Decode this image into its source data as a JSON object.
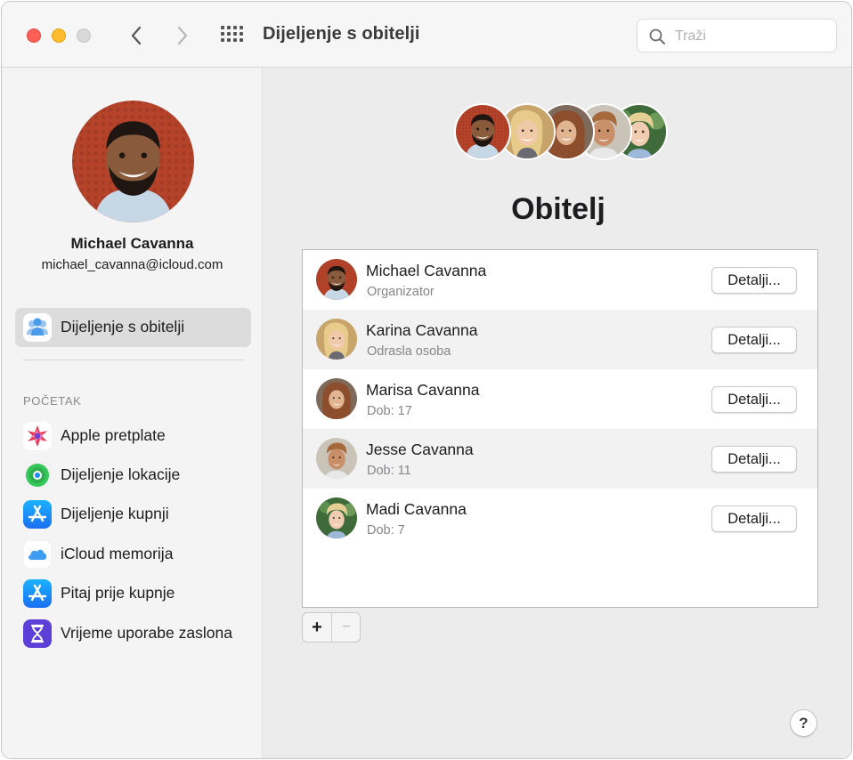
{
  "window": {
    "title": "Dijeljenje s obitelji",
    "search_placeholder": "Traži",
    "traffic_light_colors": {
      "close": "#fe5f57",
      "minimize": "#febc2e",
      "zoom": "#d9d9d9"
    }
  },
  "toolbar": {
    "back_icon": "chevron-left-icon",
    "forward_icon": "chevron-right-icon",
    "grid_icon": "grid-icon",
    "search_icon": "search-icon"
  },
  "sidebar": {
    "profile": {
      "name": "Michael Cavanna",
      "email": "michael_cavanna@icloud.com"
    },
    "family_item": {
      "label": "Dijeljenje s obitelji",
      "icon": "family-icon"
    },
    "section_header": "POČETAK",
    "items": [
      {
        "label": "Apple pretplate",
        "icon": "subscriptions-icon"
      },
      {
        "label": "Dijeljenje lokacije",
        "icon": "find-my-icon"
      },
      {
        "label": "Dijeljenje kupnji",
        "icon": "app-store-icon"
      },
      {
        "label": "iCloud memorija",
        "icon": "icloud-icon"
      },
      {
        "label": "Pitaj prije kupnje",
        "icon": "app-store-icon"
      },
      {
        "label": "Vrijeme uporabe zaslona",
        "icon": "hourglass-icon"
      }
    ]
  },
  "main": {
    "title": "Obitelj",
    "details_label": "Detalji...",
    "members": [
      {
        "name": "Michael Cavanna",
        "role": "Organizator"
      },
      {
        "name": "Karina Cavanna",
        "role": "Odrasla osoba"
      },
      {
        "name": "Marisa Cavanna",
        "role": "Dob: 17"
      },
      {
        "name": "Jesse Cavanna",
        "role": "Dob: 11"
      },
      {
        "name": "Madi Cavanna",
        "role": "Dob: 7"
      }
    ],
    "add_label": "+",
    "remove_label": "−",
    "help_label": "?"
  },
  "colors": {
    "selected_item_bg": "#dcdcdc",
    "accent_blue": "#1a8cff",
    "screen_time_purple": "#5b3fd6"
  }
}
